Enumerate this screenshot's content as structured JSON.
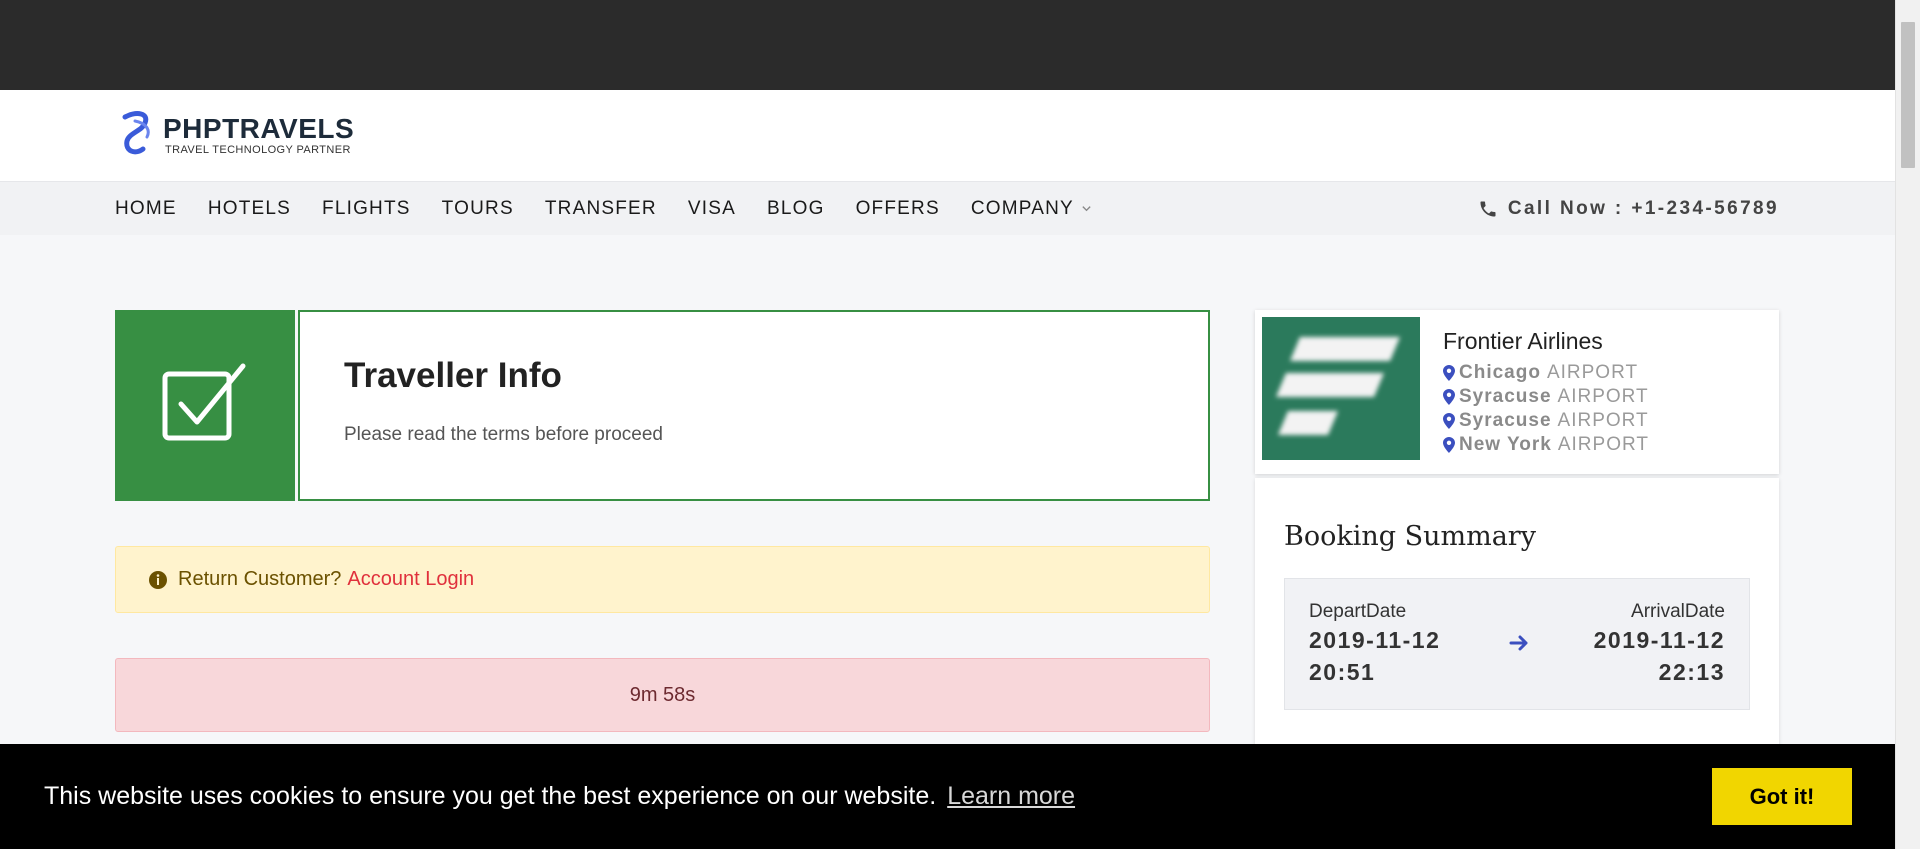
{
  "brand": {
    "name": "PHPTRAVELS",
    "tagline": "TRAVEL TECHNOLOGY PARTNER"
  },
  "nav": {
    "items": [
      "HOME",
      "HOTELS",
      "FLIGHTS",
      "TOURS",
      "TRANSFER",
      "VISA",
      "BLOG",
      "OFFERS",
      "COMPANY"
    ],
    "call_text": "Call Now : +1-234-56789"
  },
  "step": {
    "title": "Traveller Info",
    "description": "Please read the terms before proceed"
  },
  "login_alert": {
    "text": "Return Customer?",
    "link": "Account Login"
  },
  "timer": {
    "text": "9m 58s"
  },
  "flight": {
    "airline": "Frontier Airlines",
    "airports": [
      {
        "city": "Chicago",
        "suffix": "AIRPORT"
      },
      {
        "city": "Syracuse",
        "suffix": "AIRPORT"
      },
      {
        "city": "Syracuse",
        "suffix": "AIRPORT"
      },
      {
        "city": "New York",
        "suffix": "AIRPORT"
      }
    ]
  },
  "summary": {
    "title": "Booking Summary",
    "depart_label": "DepartDate",
    "depart_date": "2019-11-12",
    "depart_time": "20:51",
    "arrival_label": "ArrivalDate",
    "arrival_date": "2019-11-12",
    "arrival_time": "22:13"
  },
  "cookie": {
    "message": "This website uses cookies to ensure you get the best experience on our website.",
    "link": "Learn more",
    "button": "Got it!"
  },
  "colors": {
    "step_green": "#378f43",
    "nav_bg": "#f1f2f4",
    "cookie_button": "#f1d600",
    "link_red": "#e0303c",
    "accent_blue": "#3b4fbf"
  }
}
